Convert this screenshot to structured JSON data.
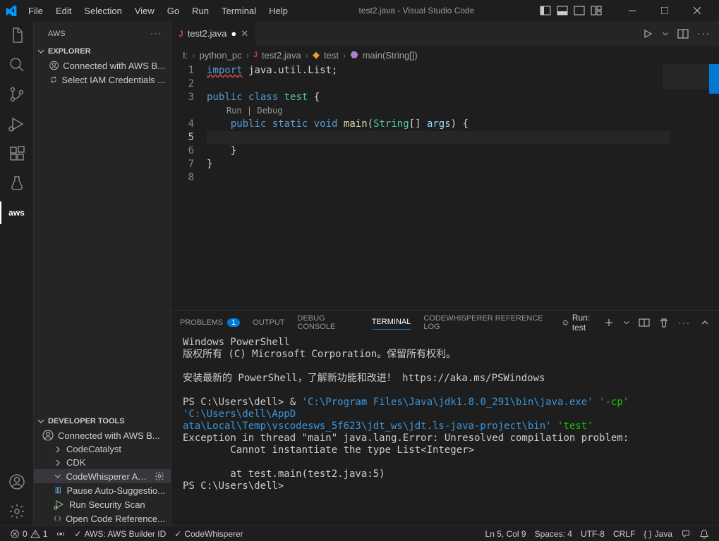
{
  "titlebar": {
    "menus": [
      "File",
      "Edit",
      "Selection",
      "View",
      "Go",
      "Run",
      "Terminal",
      "Help"
    ],
    "title": "test2.java - Visual Studio Code"
  },
  "sidebar": {
    "title": "AWS",
    "section1": {
      "title": "EXPLORER",
      "items": [
        {
          "icon": "user-circle",
          "label": "Connected with AWS B..."
        },
        {
          "icon": "sync",
          "label": "Select IAM Credentials ..."
        }
      ]
    },
    "section2": {
      "title": "DEVELOPER TOOLS",
      "connected": {
        "icon": "user-circle",
        "label": "Connected with AWS B..."
      },
      "items": [
        {
          "label": "CodeCatalyst"
        },
        {
          "label": "CDK"
        }
      ],
      "codewhisperer": {
        "label": "CodeWhisperer  AW...",
        "children": [
          {
            "icon": "pause",
            "label": "Pause Auto-Suggestio..."
          },
          {
            "icon": "bug-run",
            "label": "Run Security Scan"
          },
          {
            "icon": "ref",
            "label": "Open Code Reference..."
          }
        ]
      }
    }
  },
  "tabs": {
    "tab1": {
      "label": "test2.java",
      "dirty": true
    }
  },
  "breadcrumb": {
    "parts": [
      "I:",
      "python_pc",
      "test2.java",
      "test",
      "main(String[])"
    ]
  },
  "editor": {
    "codelens": "Run | Debug",
    "lines": {
      "l1": {
        "import": "import",
        "pkg": "java.util.List",
        "semi": ";"
      },
      "l3": {
        "public": "public",
        "class": "class",
        "name": "test",
        "brace": " {"
      },
      "l4": {
        "public": "public",
        "static": "static",
        "void": "void",
        "main": "main",
        "open": "(",
        "stringType": "String",
        "brackets": "[] ",
        "args": "args",
        "close": ") {"
      },
      "l6": {
        "brace": "}"
      },
      "l7": {
        "brace": "}"
      }
    },
    "lineNumbers": [
      "1",
      "2",
      "3",
      "",
      "4",
      "5",
      "6",
      "7",
      "8"
    ]
  },
  "panel": {
    "tabs": {
      "problems": "PROBLEMS",
      "problemsBadge": "1",
      "output": "OUTPUT",
      "debug": "DEBUG CONSOLE",
      "terminal": "TERMINAL",
      "cw": "CODEWHISPERER REFERENCE LOG"
    },
    "actions": {
      "run": "Run: test"
    },
    "terminal": {
      "l1": "Windows PowerShell",
      "l2": "版权所有 (C)  Microsoft Corporation。保留所有权利。",
      "l3": "安装最新的 PowerShell，了解新功能和改进！ https://aka.ms/PSWindows",
      "l4a": "PS C:\\Users\\dell>  & ",
      "l4b": "'C:\\Program Files\\Java\\jdk1.8.0_291\\bin\\java.exe'",
      "l4c": " '-cp' ",
      "l4d": "'C:\\Users\\dell\\AppD",
      "l5": "ata\\Local\\Temp\\vscodesws_5f623\\jdt_ws\\jdt.ls-java-project\\bin'",
      "l5b": " 'test'",
      "l6": "Exception in thread \"main\" java.lang.Error: Unresolved compilation problem:",
      "l7": "        Cannot instantiate the type List<Integer>",
      "l8": "        at test.main(test2.java:5)",
      "l9": "PS C:\\Users\\dell>"
    }
  },
  "statusbar": {
    "errors": "0",
    "warnings": "1",
    "aws": "AWS: AWS Builder ID",
    "cw": "CodeWhisperer",
    "pos": "Ln 5, Col 9",
    "spaces": "Spaces: 4",
    "encoding": "UTF-8",
    "eol": "CRLF",
    "lang": "Java"
  }
}
